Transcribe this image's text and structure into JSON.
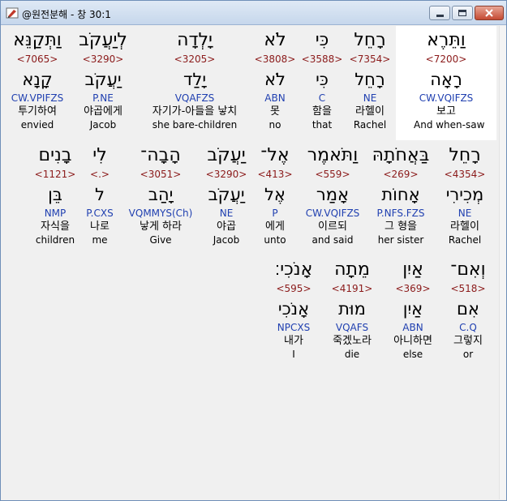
{
  "window": {
    "title": "@원전분해 - 창 30:1"
  },
  "rows": [
    {
      "words": [
        {
          "heb": "וַתֵּרֶא",
          "strong": "<7200>",
          "lemma": "רָאָה",
          "parse": "CW.VQIFZS",
          "kor": "보고",
          "eng": "And when-saw",
          "selected": true
        },
        {
          "heb": "רָחֵל",
          "strong": "<7354>",
          "lemma": "רָחֵל",
          "parse": "NE",
          "kor": "라헬이",
          "eng": "Rachel"
        },
        {
          "heb": "כִּי",
          "strong": "<3588>",
          "lemma": "כִּי",
          "parse": "C",
          "kor": "함을",
          "eng": "that"
        },
        {
          "heb": "לֹא",
          "strong": "<3808>",
          "lemma": "לֹא",
          "parse": "ABN",
          "kor": "못",
          "eng": "no"
        },
        {
          "heb": "יָלְדָה",
          "strong": "<3205>",
          "lemma": "יָלַד",
          "parse": "VQAFZS",
          "kor": "자기가-아들을 낳치",
          "eng": "she bare-children"
        },
        {
          "heb": "לְיַעֲקֹב",
          "strong": "<3290>",
          "lemma": "יַעֲקֹב",
          "parse": "P.NE",
          "kor": "야곱에게",
          "eng": "Jacob"
        },
        {
          "heb": "וַתְּקַנֵּא",
          "strong": "<7065>",
          "lemma": "קָנָא",
          "parse": "CW.VPIFZS",
          "kor": "투기하여",
          "eng": "envied"
        }
      ]
    },
    {
      "words": [
        {
          "heb": "רָחֵל",
          "strong": "<4354>",
          "lemma": "מְכִירִי",
          "parse": "NE",
          "kor": "라헬이",
          "eng": "Rachel"
        },
        {
          "heb": "בַּאֲחֹתָהּ",
          "strong": "<269>",
          "lemma": "אָחוֹת",
          "parse": "P.NFS.FZS",
          "kor": "그 형을",
          "eng": "her sister"
        },
        {
          "heb": "וַתֹּאמֶר",
          "strong": "<559>",
          "lemma": "אָמַר",
          "parse": "CW.VQIFZS",
          "kor": "이르되",
          "eng": "and said"
        },
        {
          "heb": "אֶל־",
          "strong": "<413>",
          "lemma": "אֶל",
          "parse": "P",
          "kor": "에게",
          "eng": "unto"
        },
        {
          "heb": "יַעֲקֹב",
          "strong": "<3290>",
          "lemma": "יַעֲקֹב",
          "parse": "NE",
          "kor": "야곱",
          "eng": "Jacob"
        },
        {
          "heb": "הָבָה־",
          "strong": "<3051>",
          "lemma": "יָהַב",
          "parse": "VQMMYS(Ch)",
          "kor": "낳게 하라",
          "eng": "Give"
        },
        {
          "heb": "לִי",
          "strong": "<.>",
          "lemma": "ל",
          "parse": "P.CXS",
          "kor": "나로",
          "eng": "me"
        },
        {
          "heb": "בָנִים",
          "strong": "<1121>",
          "lemma": "בֵּן",
          "parse": "NMP",
          "kor": "자식을",
          "eng": "children"
        }
      ]
    },
    {
      "words": [
        {
          "heb": "וְאִם־",
          "strong": "<518>",
          "lemma": "אִם",
          "parse": "C.Q",
          "kor": "그렇지",
          "eng": "or"
        },
        {
          "heb": "אַיִן",
          "strong": "<369>",
          "lemma": "אַיִן",
          "parse": "ABN",
          "kor": "아니하면",
          "eng": "else"
        },
        {
          "heb": "מֵתָה",
          "strong": "<4191>",
          "lemma": "מוּת",
          "parse": "VQAFS",
          "kor": "죽겠노라",
          "eng": "die"
        },
        {
          "heb": "אָנֹכִי׃",
          "strong": "<595>",
          "lemma": "אָנֹכִי",
          "parse": "NPCXS",
          "kor": "내가",
          "eng": "I"
        }
      ]
    }
  ]
}
